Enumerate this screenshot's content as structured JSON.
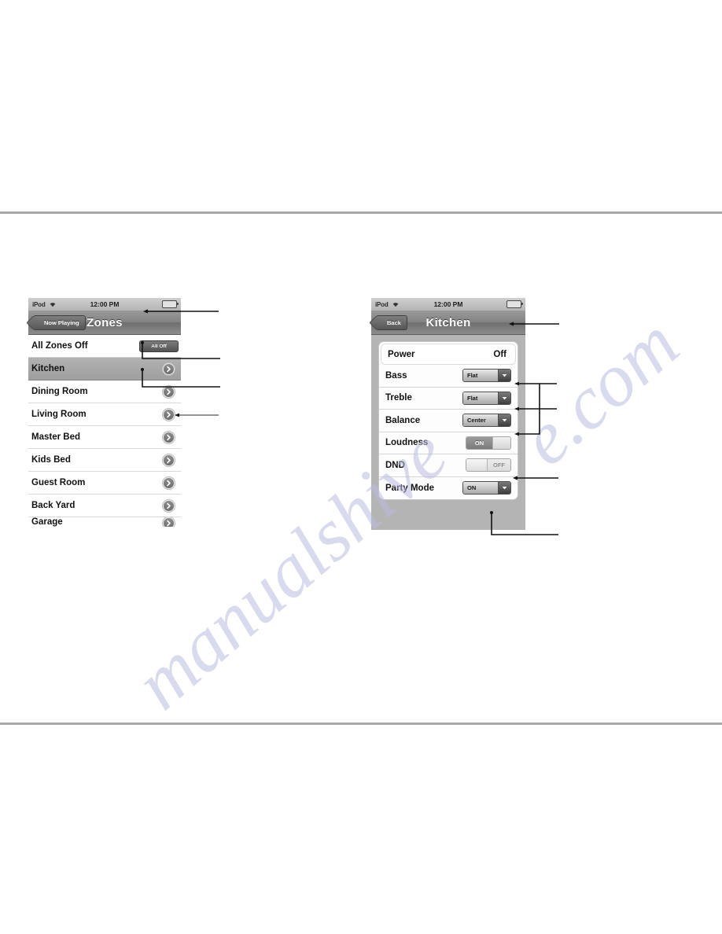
{
  "status_bar": {
    "carrier": "iPod",
    "time": "12:00 PM",
    "wifi_icon": "wifi-icon",
    "battery_icon": "battery-icon"
  },
  "zones_screen": {
    "nav": {
      "back_button": "Now Playing",
      "title": "Zones"
    },
    "all_zones": {
      "label": "All Zones Off",
      "button": "All Off"
    },
    "zones": [
      {
        "name": "Kitchen",
        "selected": true,
        "clipped": false
      },
      {
        "name": "Dining Room",
        "selected": false,
        "clipped": false
      },
      {
        "name": "Living Room",
        "selected": false,
        "clipped": false
      },
      {
        "name": "Master Bed",
        "selected": false,
        "clipped": false
      },
      {
        "name": "Kids Bed",
        "selected": false,
        "clipped": false
      },
      {
        "name": "Guest Room",
        "selected": false,
        "clipped": false
      },
      {
        "name": "Back Yard",
        "selected": false,
        "clipped": false
      },
      {
        "name": "Garage",
        "selected": false,
        "clipped": true
      }
    ]
  },
  "kitchen_screen": {
    "nav": {
      "back_button": "Back",
      "title": "Kitchen"
    },
    "settings": [
      {
        "label": "Power",
        "control": "value",
        "value": "Off"
      },
      {
        "label": "Bass",
        "control": "dropdown",
        "value": "Flat"
      },
      {
        "label": "Treble",
        "control": "dropdown",
        "value": "Flat"
      },
      {
        "label": "Balance",
        "control": "dropdown",
        "value": "Center"
      },
      {
        "label": "Loudness",
        "control": "toggle",
        "value": "ON"
      },
      {
        "label": "DND",
        "control": "toggle",
        "value": "OFF"
      },
      {
        "label": "Party Mode",
        "control": "dropdown",
        "value": "ON"
      }
    ]
  },
  "watermark": {
    "line1": "manualshive",
    "line2": "e.com"
  },
  "colors": {
    "rule": "#a8a8a8",
    "nav_bar": "#848484",
    "selected_row": "#a9a9a9",
    "watermark": "#babcdf"
  }
}
